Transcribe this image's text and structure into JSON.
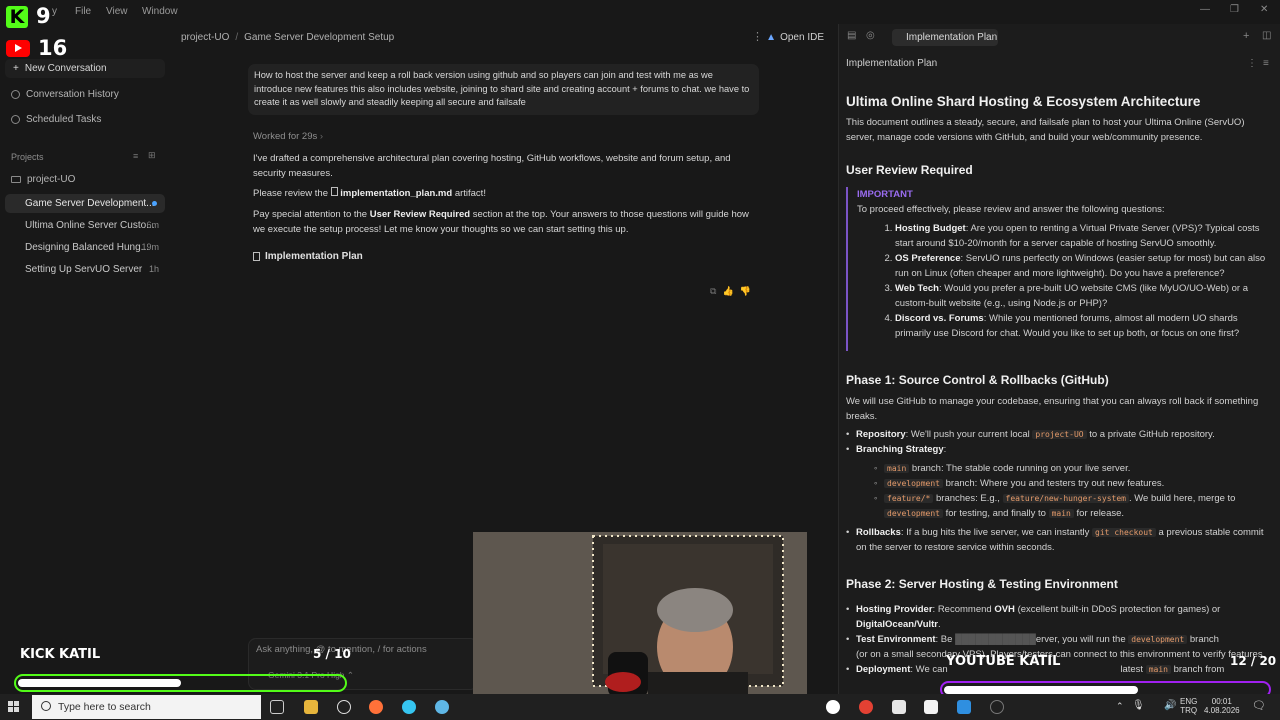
{
  "menu": {
    "items": [
      "File",
      "View",
      "Window"
    ],
    "partial_item": "y"
  },
  "sidebar": {
    "new_conversation": "New Conversation",
    "conversation_history": "Conversation History",
    "scheduled_tasks": "Scheduled Tasks",
    "projects_label": "Projects",
    "project_name": "project-UO",
    "conversations": [
      {
        "title": "Game Server Development...",
        "time": "",
        "active": true
      },
      {
        "title": "Ultima Online Server Custo...",
        "time": "6m",
        "active": false
      },
      {
        "title": "Designing Balanced Hung...",
        "time": "19m",
        "active": false
      },
      {
        "title": "Setting Up ServUO Server",
        "time": "1h",
        "active": false
      }
    ]
  },
  "center": {
    "breadcrumb": {
      "project": "project-UO",
      "page": "Game Server Development Setup"
    },
    "open_ide": "Open IDE",
    "user_message": "How to host the server and keep a roll back version using github and so players can join and test with me as we introduce new features this also includes website, joining to shard site and creating account + forums to chat. we have to create it as well slowly and steadily keeping all secure and failsafe",
    "worked_for": "Worked for 29s",
    "response": {
      "p1": "I've drafted a comprehensive architectural plan covering hosting, GitHub workflows, website and forum setup, and security measures.",
      "p2_pre": "Please review the",
      "p2_file": "implementation_plan.md",
      "p2_post": "artifact!",
      "p3_pre": "Pay special attention to the",
      "p3_bold": "User Review Required",
      "p3_post": "section at the top. Your answers to those questions will guide how we execute the setup process! Let me know your thoughts so we can start setting this up."
    },
    "artifact_chip": "Implementation Plan",
    "input_placeholder": "Ask anything, @ to mention, / for actions",
    "model_label": "Gemini 3.1 Pro High"
  },
  "right_panel": {
    "tab": "Implementation Plan",
    "header": "Implementation Plan",
    "title": "Ultima Online Shard Hosting & Ecosystem Architecture",
    "intro": "This document outlines a steady, secure, and failsafe plan to host your Ultima Online (ServUO) server, manage code versions with GitHub, and build your web/community presence.",
    "review_heading": "User Review Required",
    "important_label": "IMPORTANT",
    "important_intro": "To proceed effectively, please review and answer the following questions:",
    "questions": [
      {
        "label": "Hosting Budget",
        "text": ": Are you open to renting a Virtual Private Server (VPS)? Typical costs start around $10-20/month for a server capable of hosting ServUO smoothly."
      },
      {
        "label": "OS Preference",
        "text": ": ServUO runs perfectly on Windows (easier setup for most) but can also run on Linux (often cheaper and more lightweight). Do you have a preference?"
      },
      {
        "label": "Web Tech",
        "text": ": Would you prefer a pre-built UO website CMS (like MyUO/UO-Web) or a custom-built website (e.g., using Node.js or PHP)?"
      },
      {
        "label": "Discord vs. Forums",
        "text": ": While you mentioned forums, almost all modern UO shards primarily use Discord for chat. Would you like to set up both, or focus on one first?"
      }
    ],
    "phase1_heading": "Phase 1: Source Control & Rollbacks (GitHub)",
    "phase1_intro": "We will use GitHub to manage your codebase, ensuring that you can always roll back if something breaks.",
    "repo_label": "Repository",
    "repo_text_pre": ": We'll push your current local",
    "repo_code": "project-UO",
    "repo_text_post": "to a private GitHub repository.",
    "branching_label": "Branching Strategy",
    "branches": [
      {
        "code": "main",
        "text": "branch: The stable code running on your live server."
      },
      {
        "code": "development",
        "text": "branch: Where you and testers try out new features."
      },
      {
        "code": "feature/*",
        "text": "branches: E.g.,",
        "code2": "feature/new-hunger-system",
        "text2": ". We build here, merge to",
        "code3": "development",
        "text3": "for testing, and finally to",
        "code4": "main",
        "text4": "for release."
      }
    ],
    "rollbacks_label": "Rollbacks",
    "rollbacks_pre": ": If a bug hits the live server, we can instantly",
    "rollbacks_code": "git checkout",
    "rollbacks_post": "a previous stable commit on the server to restore service within seconds.",
    "phase2_heading": "Phase 2: Server Hosting & Testing Environment",
    "hosting_label": "Hosting Provider",
    "hosting_text_pre": ": Recommend",
    "hosting_ovh": "OVH",
    "hosting_text_mid": "(excellent built-in DDoS protection for games) or",
    "hosting_do": "DigitalOcean/Vultr",
    "test_label": "Test Environment",
    "test_text_pre": ": Be",
    "test_text_mid": "erver, you will run the",
    "test_code": "development",
    "test_text_post": "branch",
    "test_line2": "(or on a small secondary VPS). Players/testers can connect to this environment to verify features.",
    "deploy_label": "Deployment",
    "deploy_text": ": We can",
    "deploy_tail": "latest",
    "deploy_code": "main",
    "deploy_end": "branch from"
  },
  "overlay": {
    "kick_count": "9",
    "youtube_count": "16",
    "kick_label": "KICK KATIL",
    "kick_progress_text": "5 / 10",
    "kick_progress": 0.5,
    "youtube_label": "YOUTUBE KATIL",
    "youtube_progress_text": "12 / 20",
    "youtube_progress": 0.6
  },
  "taskbar": {
    "search_placeholder": "Type here to search",
    "lang_top": "ENG",
    "lang_bottom": "TRQ",
    "time": "00:01",
    "date": "4.08.2026"
  }
}
